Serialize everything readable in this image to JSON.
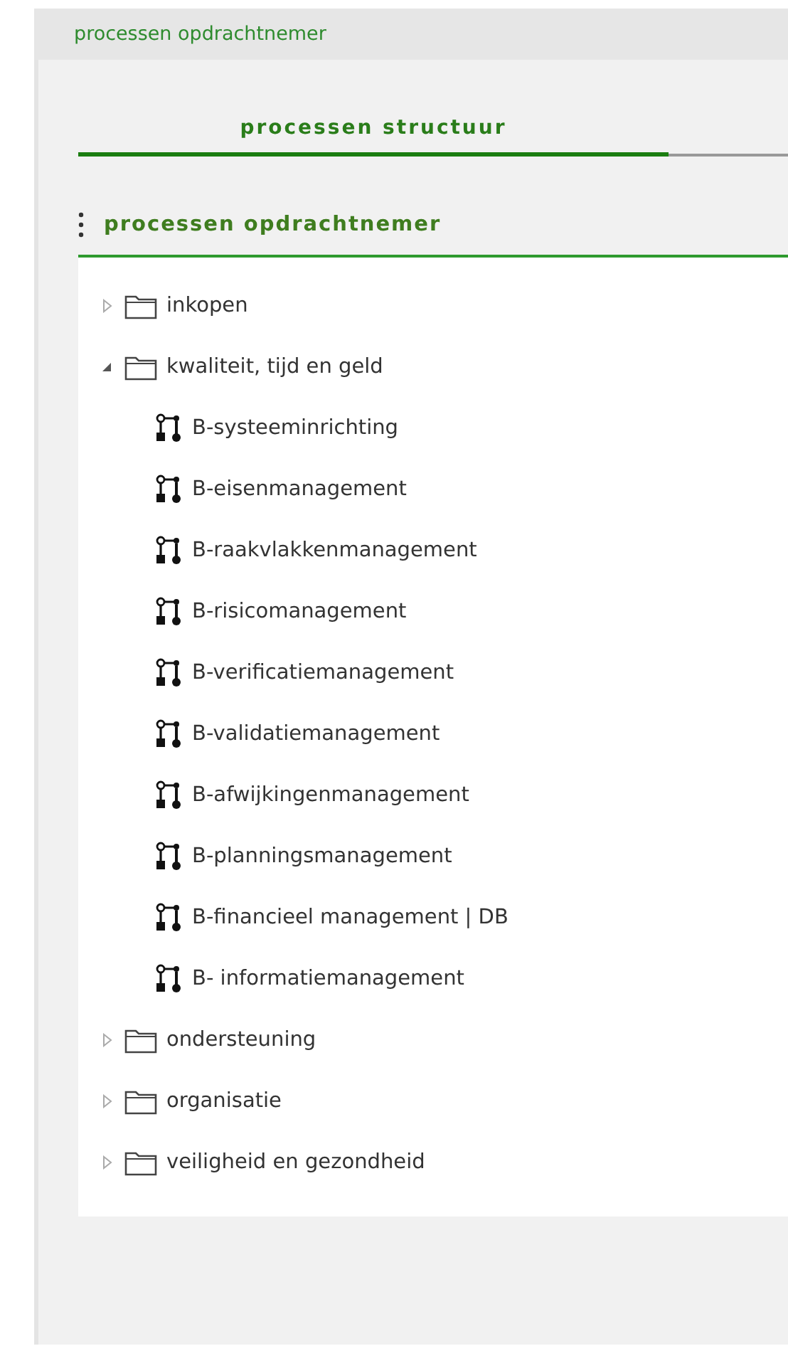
{
  "header": {
    "title": "processen opdrachtnemer"
  },
  "tabs": [
    {
      "label": "processen structuur",
      "selected": true
    }
  ],
  "section": {
    "title": "processen opdrachtnemer"
  },
  "tree": [
    {
      "kind": "folder",
      "label": "inkopen",
      "expanded": false
    },
    {
      "kind": "folder",
      "label": "kwaliteit, tijd en geld",
      "expanded": true,
      "children": [
        {
          "kind": "process",
          "label": "B-systeeminrichting"
        },
        {
          "kind": "process",
          "label": "B-eisenmanagement"
        },
        {
          "kind": "process",
          "label": "B-raakvlakkenmanagement"
        },
        {
          "kind": "process",
          "label": "B-risicomanagement"
        },
        {
          "kind": "process",
          "label": "B-verificatiemanagement"
        },
        {
          "kind": "process",
          "label": "B-validatiemanagement"
        },
        {
          "kind": "process",
          "label": "B-afwijkingenmanagement"
        },
        {
          "kind": "process",
          "label": "B-planningsmanagement"
        },
        {
          "kind": "process",
          "label": "B-financieel management | DB"
        },
        {
          "kind": "process",
          "label": "B- informatiemanagement"
        }
      ]
    },
    {
      "kind": "folder",
      "label": "ondersteuning",
      "expanded": false
    },
    {
      "kind": "folder",
      "label": "organisatie",
      "expanded": false
    },
    {
      "kind": "folder",
      "label": "veiligheid en gezondheid",
      "expanded": false
    }
  ]
}
